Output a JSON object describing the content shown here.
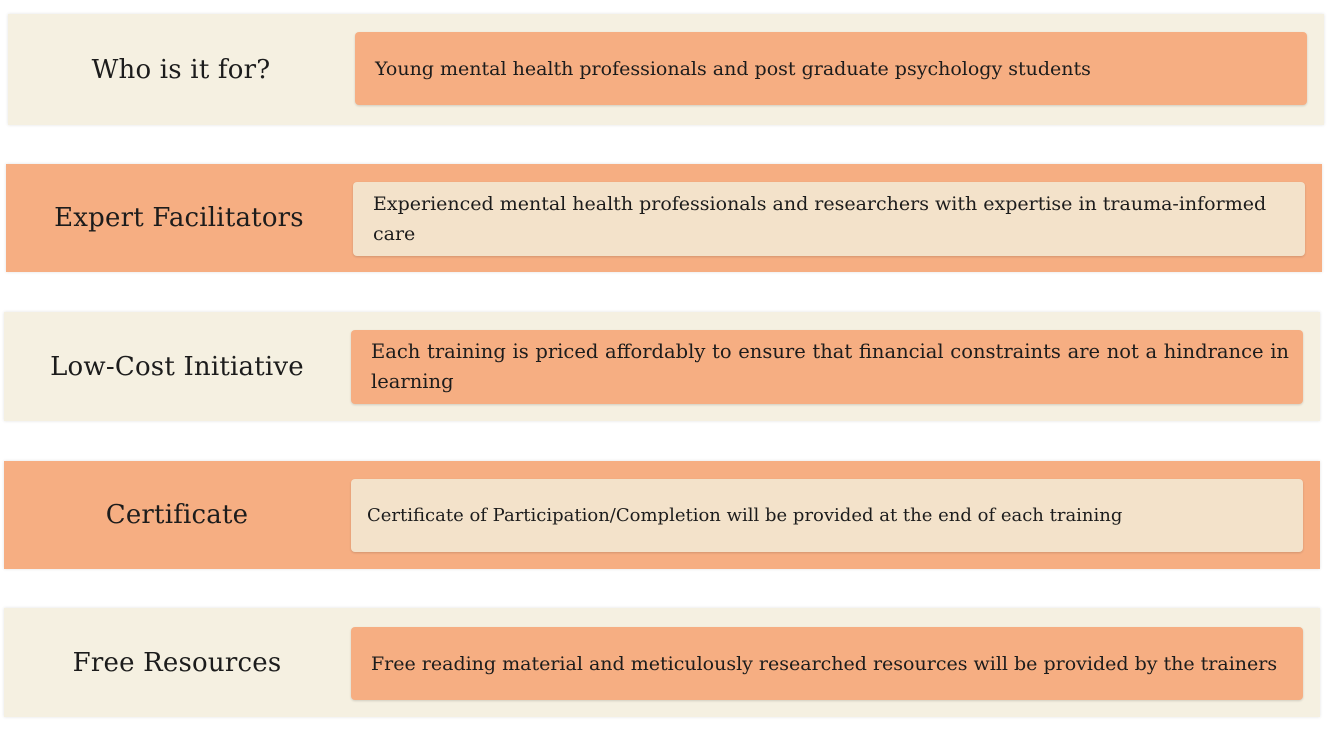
{
  "rows": [
    {
      "label": "Who is it for?",
      "description": "Young mental health professionals and post graduate psychology students"
    },
    {
      "label": "Expert Facilitators",
      "description": "Experienced mental health professionals and researchers with expertise in trauma-informed care"
    },
    {
      "label": "Low-Cost Initiative",
      "description": "Each training is priced affordably to ensure that financial constraints are not a hindrance in learning"
    },
    {
      "label": "Certificate",
      "description": "Certificate of Participation/Completion will be provided at the end of each training"
    },
    {
      "label": "Free Resources",
      "description": "Free reading material and meticulously researched resources will be provided by the trainers"
    }
  ],
  "colors": {
    "cream_row": "#f5f0e1",
    "orange_row": "#f6ae82",
    "cream_box": "#f3e2ca",
    "orange_box": "#f6ae82"
  }
}
